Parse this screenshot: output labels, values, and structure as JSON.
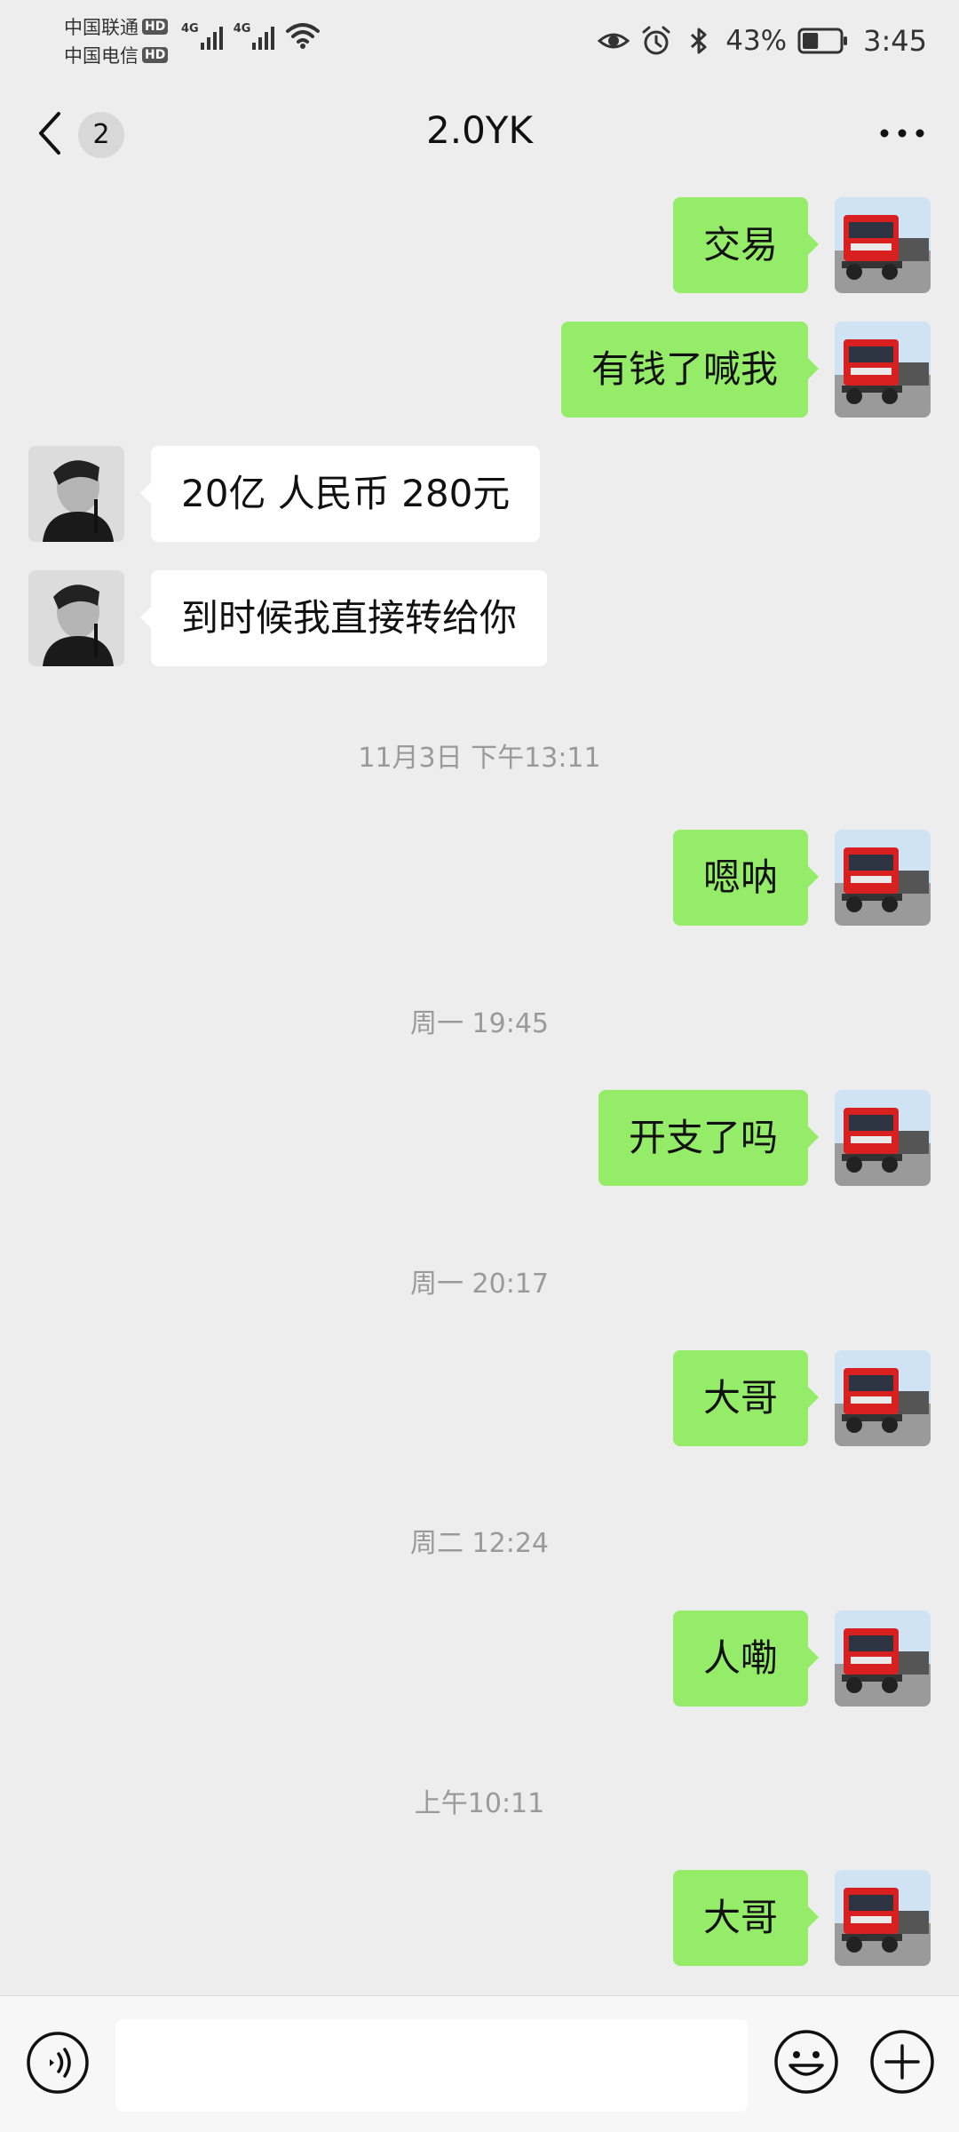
{
  "status_bar": {
    "carrier_1": "中国联通",
    "carrier_2": "中国电信",
    "hd_badge": "HD",
    "net_tag_1": "4G",
    "net_tag_2": "4G",
    "battery_percent": "43%",
    "battery_level": 0.43,
    "time": "3:45",
    "icons": [
      "eye-icon",
      "alarm-icon",
      "bluetooth-icon",
      "battery-icon",
      "wifi-icon",
      "signal-icon"
    ]
  },
  "header": {
    "unread_count": "2",
    "title": "2.0YK"
  },
  "messages": [
    {
      "type": "message",
      "from": "me",
      "text": "交易"
    },
    {
      "type": "message",
      "from": "me",
      "text": "有钱了喊我"
    },
    {
      "type": "message",
      "from": "them",
      "text": "20亿 人民币 280元"
    },
    {
      "type": "message",
      "from": "them",
      "text": "到时候我直接转给你"
    },
    {
      "type": "time",
      "text": "11月3日 下午13:11"
    },
    {
      "type": "message",
      "from": "me",
      "text": "嗯呐"
    },
    {
      "type": "time",
      "text": "周一 19:45"
    },
    {
      "type": "message",
      "from": "me",
      "text": "开支了吗"
    },
    {
      "type": "time",
      "text": "周一 20:17"
    },
    {
      "type": "message",
      "from": "me",
      "text": "大哥"
    },
    {
      "type": "time",
      "text": "周二 12:24"
    },
    {
      "type": "message",
      "from": "me",
      "text": "人嘞"
    },
    {
      "type": "time",
      "text": "上午10:11"
    },
    {
      "type": "message",
      "from": "me",
      "text": "大哥"
    }
  ],
  "input_bar": {
    "text_value": "",
    "icons": [
      "voice-icon",
      "emoji-icon",
      "plus-icon"
    ]
  },
  "colors": {
    "background": "#ededed",
    "my_bubble": "#95ec69",
    "their_bubble": "#ffffff",
    "timestamp_text": "#9a9a9a"
  }
}
